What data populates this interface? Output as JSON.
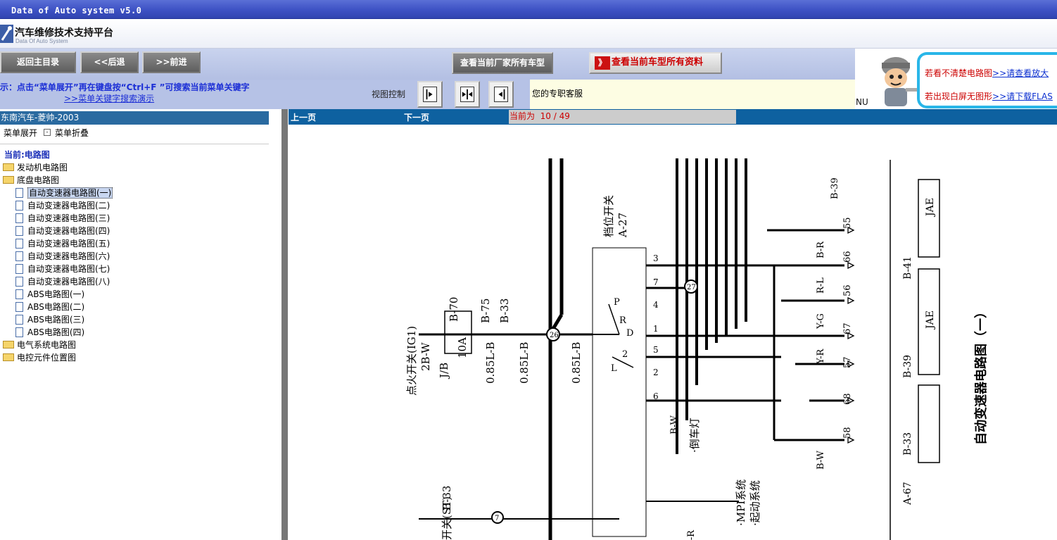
{
  "window": {
    "title": "Data of Auto system v5.0"
  },
  "brand": {
    "title": "汽车维修技术支持平台",
    "subtitle": "Data Of Auto System"
  },
  "toolbar": {
    "home": "返回主目录",
    "back": "<<后退",
    "forward": ">>前进",
    "all_models": "查看当前厂家所有车型",
    "all_data": "查看当前车型所有资料",
    "all_data_icon": "》"
  },
  "hint": {
    "line1": "示：点击“菜单展开”再在键盘按“Ctrl+F ”可搜索当前菜单关键字",
    "demo_link": ">>菜单关键字搜索演示"
  },
  "view_control": {
    "label": "视图控制"
  },
  "service": {
    "text": "您的专职客服"
  },
  "ad": {
    "line1": "若看不清楚电路图",
    "link1": ">>请查看放大",
    "line2": "若出现白屏无图形",
    "link2": ">>请下载FLAS",
    "nu": "NU"
  },
  "sidebar": {
    "header": "东南汽车-菱帅-2003",
    "expand": "菜单展开",
    "collapse": "菜单折叠",
    "current": "当前:电路图",
    "folders": [
      "发动机电路图",
      "底盘电路图",
      "电气系统电路图",
      "电控元件位置图"
    ],
    "docs": [
      "自动变速器电路图(一)",
      "自动变速器电路图(二)",
      "自动变速器电路图(三)",
      "自动变速器电路图(四)",
      "自动变速器电路图(五)",
      "自动变速器电路图(六)",
      "自动变速器电路图(七)",
      "自动变速器电路图(八)",
      "ABS电路图(一)",
      "ABS电路图(二)",
      "ABS电路图(三)",
      "ABS电路图(四)"
    ]
  },
  "viewer": {
    "prev": "上一页",
    "next": "下一页",
    "current_label": "当前为",
    "current_page": "10 / 49"
  },
  "diagram": {
    "title": "自动变速器电路图（一）",
    "ignition": "点火开关(IG1)",
    "starter": "开关(ST)",
    "shift_switch": "档位开关",
    "conn_a27": "A-27",
    "conn_b70": "B-70",
    "conn_b75": "B-75",
    "conn_b33": "B-33",
    "conn_b39": "B-39",
    "conn_b41": "B-41",
    "conn_a67": "A-67",
    "wire_2bw": "2B-W",
    "wire_jb": "J/B",
    "wire_10a": "10A",
    "wire_085lb": "0.85L-B",
    "wire_bw": "B-W",
    "wire_br": "B-R",
    "wire_yg": "Y-G",
    "wire_yr": "Y-R",
    "wire_rl": "R-L",
    "reverse_lamp": "·倒车灯",
    "mpi": "·MPI系统",
    "start_sys": "·起动系统",
    "jae": "JAE",
    "node26": "26",
    "node27": "27",
    "node7": "7",
    "pin_labels": [
      "55",
      "66",
      "56",
      "67",
      "57",
      "68",
      "58"
    ],
    "switch_pins": [
      "3",
      "7",
      "4",
      "1",
      "5",
      "2",
      "6"
    ]
  }
}
